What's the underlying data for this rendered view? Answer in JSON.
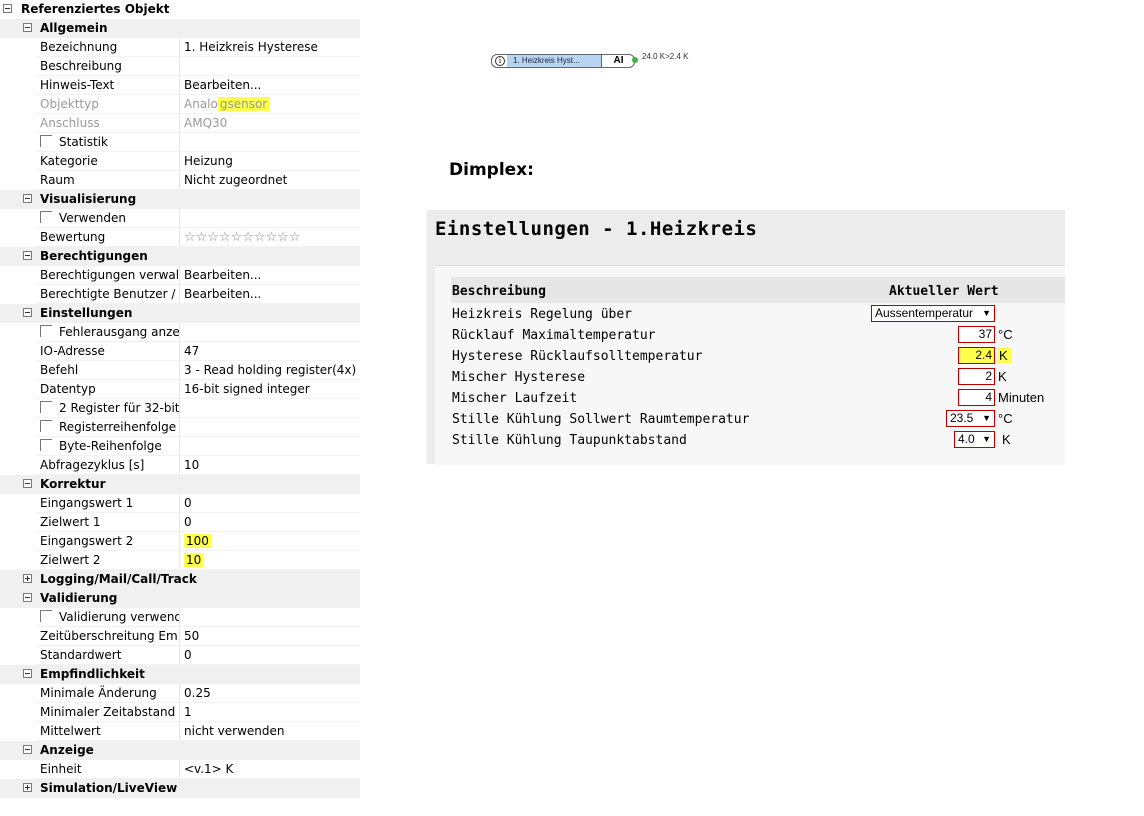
{
  "property_grid": {
    "root": "Referenziertes Objekt",
    "categories": {
      "allgemein": "Allgemein",
      "visualisierung": "Visualisierung",
      "berechtigungen": "Berechtigungen",
      "einstellungen": "Einstellungen",
      "korrektur": "Korrektur",
      "logging": "Logging/Mail/Call/Track",
      "validierung": "Validierung",
      "empfindlichkeit": "Empfindlichkeit",
      "anzeige": "Anzeige",
      "simulation": "Simulation/LiveView"
    },
    "props": {
      "bezeichnung": {
        "name": "Bezeichnung",
        "value": "1. Heizkreis Hysterese"
      },
      "beschreibung": {
        "name": "Beschreibung",
        "value": ""
      },
      "hinweis": {
        "name": "Hinweis-Text",
        "value": "Bearbeiten..."
      },
      "objekttyp": {
        "name": "Objekttyp",
        "value_a": "Analo",
        "value_b": "gsensor"
      },
      "anschluss": {
        "name": "Anschluss",
        "value": "AMQ30"
      },
      "statistik": {
        "name": "Statistik"
      },
      "kategorie": {
        "name": "Kategorie",
        "value": "Heizung"
      },
      "raum": {
        "name": "Raum",
        "value": "Nicht zugeordnet"
      },
      "verwenden": {
        "name": "Verwenden"
      },
      "bewertung": {
        "name": "Bewertung",
        "value": "☆☆☆☆☆☆☆☆☆☆"
      },
      "berecht_verw": {
        "name": "Berechtigungen verwalt...",
        "value": "Bearbeiten..."
      },
      "berecht_ben": {
        "name": "Berechtigte Benutzer / ...",
        "value": "Bearbeiten..."
      },
      "fehlerausgang": {
        "name": "Fehlerausgang anzei..."
      },
      "io_adresse": {
        "name": "IO-Adresse",
        "value": "47"
      },
      "befehl": {
        "name": "Befehl",
        "value": "3 - Read holding register(4x)"
      },
      "datentyp": {
        "name": "Datentyp",
        "value": "16-bit signed integer"
      },
      "reg32": {
        "name": "2 Register für 32-bit"
      },
      "regreihe": {
        "name": "Registerreihenfolge"
      },
      "bytereihe": {
        "name": "Byte-Reihenfolge"
      },
      "abfragezyklus": {
        "name": "Abfragezyklus [s]",
        "value": "10"
      },
      "eingang1": {
        "name": "Eingangswert 1",
        "value": "0"
      },
      "ziel1": {
        "name": "Zielwert 1",
        "value": "0"
      },
      "eingang2": {
        "name": "Eingangswert 2",
        "value": "100"
      },
      "ziel2": {
        "name": "Zielwert 2",
        "value": "10"
      },
      "validierung_verw": {
        "name": "Validierung verwend..."
      },
      "zeitueberschreitung": {
        "name": "Zeitüberschreitung Em...",
        "value": "50"
      },
      "standardwert": {
        "name": "Standardwert",
        "value": "0"
      },
      "min_aenderung": {
        "name": "Minimale Änderung",
        "value": "0.25"
      },
      "min_zeitabstand": {
        "name": "Minimaler Zeitabstand",
        "value": "1"
      },
      "mittelwert": {
        "name": "Mittelwert",
        "value": "nicht verwenden"
      },
      "einheit": {
        "name": "Einheit",
        "value": "<v.1> K"
      }
    }
  },
  "block": {
    "info": "i",
    "name": "1. Heizkreis Hyst...",
    "type": "AI",
    "output": "24.0 K>2.4 K"
  },
  "dimplex": {
    "label": "Dimplex:",
    "title": "Einstellungen - 1.Heizkreis",
    "headers": {
      "beschreibung": "Beschreibung",
      "aktueller_wert": "Aktueller Wert"
    },
    "rows": {
      "regelung": {
        "label": "Heizkreis Regelung über",
        "value": "Aussentemperatur"
      },
      "ruecklauf_max": {
        "label": "Rücklauf Maximaltemperatur",
        "value": "37",
        "unit": "°C"
      },
      "hysterese_rl": {
        "label": "Hysterese Rücklaufsolltemperatur",
        "value": "2.4",
        "unit": "K"
      },
      "mischer_hyst": {
        "label": "Mischer Hysterese",
        "value": "2",
        "unit": "K"
      },
      "mischer_laufzeit": {
        "label": "Mischer Laufzeit",
        "value": "4",
        "unit": "Minuten"
      },
      "stille_raum": {
        "label": "Stille Kühlung Sollwert Raumtemperatur",
        "value": "23.5",
        "unit": "°C"
      },
      "stille_taupunkt": {
        "label": "Stille Kühlung Taupunktabstand",
        "value": "4.0",
        "unit": "K"
      }
    }
  },
  "colors": {
    "highlight": "#ffff4d",
    "input_border": "#b60000",
    "block_fill": "#b8d4f0",
    "status_dot": "#3bb33b"
  },
  "icons": {
    "expand": "minus-box-icon",
    "collapsed": "plus-box-icon",
    "dropdown": "chevron-down-icon",
    "info": "info-icon"
  }
}
